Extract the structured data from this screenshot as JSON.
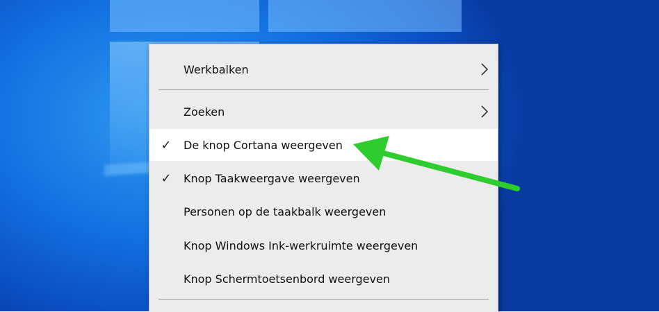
{
  "context_menu": {
    "items": [
      {
        "label": "Werkbalken",
        "checked": false,
        "has_submenu": true
      },
      {
        "label": "Zoeken",
        "checked": false,
        "has_submenu": true
      },
      {
        "label": "De knop Cortana weergeven",
        "checked": true,
        "has_submenu": false,
        "highlighted": true
      },
      {
        "label": "Knop Taakweergave weergeven",
        "checked": true,
        "has_submenu": false
      },
      {
        "label": "Personen op de taakbalk weergeven",
        "checked": false,
        "has_submenu": false
      },
      {
        "label": "Knop Windows Ink-werkruimte weergeven",
        "checked": false,
        "has_submenu": false
      },
      {
        "label": "Knop Schermtoetsenbord weergeven",
        "checked": false,
        "has_submenu": false
      }
    ],
    "check_glyph": "✓"
  },
  "annotation": {
    "color": "#2ecc2e",
    "icon": "arrow-annotation"
  },
  "colors": {
    "menu_bg": "#ececec",
    "highlight_bg": "#ffffff",
    "desktop_blue": "#1474e2"
  }
}
